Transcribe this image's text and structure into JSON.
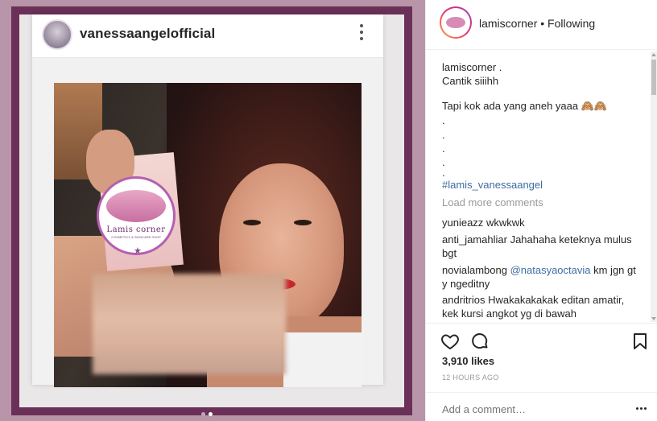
{
  "post_image": {
    "inner_username": "vanessaangelofficial",
    "logo_text": "Lamis corner",
    "logo_sub": "COSMETICS & SKINCARE SHOP",
    "logo_star": "★"
  },
  "panel": {
    "username": "lamiscorner",
    "separator": " • ",
    "follow_status": "Following",
    "caption": {
      "user": "lamiscorner .",
      "lines": [
        "Cantik siiihh",
        "",
        "Tapi kok ada yang aneh yaaa 🙈🙈",
        ".",
        ".",
        ".",
        ".",
        "."
      ],
      "hashtag": "#lamis_vanessaangel"
    },
    "load_more": "Load more comments",
    "comments": [
      {
        "user": "yunieazz",
        "text": "wkwkwk"
      },
      {
        "user": "anti_jamahliar",
        "text": "Jahahaha keteknya mulus bgt"
      },
      {
        "user": "novialambong",
        "mention": "@natasyaoctavia",
        "text": " km jgn gt y ngeditny"
      },
      {
        "user": "andritrios",
        "text": "Hwakakakakak editan amatir, kek kursi angkot yg di bawah"
      }
    ],
    "likes": "3,910 likes",
    "timestamp": "12 HOURS AGO",
    "add_comment_placeholder": "Add a comment…"
  },
  "icons": {
    "heart": "heart-icon",
    "comment": "comment-icon",
    "bookmark": "bookmark-icon",
    "more": "more-icon"
  },
  "colors": {
    "frame": "#6a3057",
    "background": "#b895a9",
    "link": "#3d6da2",
    "muted": "#999999"
  }
}
